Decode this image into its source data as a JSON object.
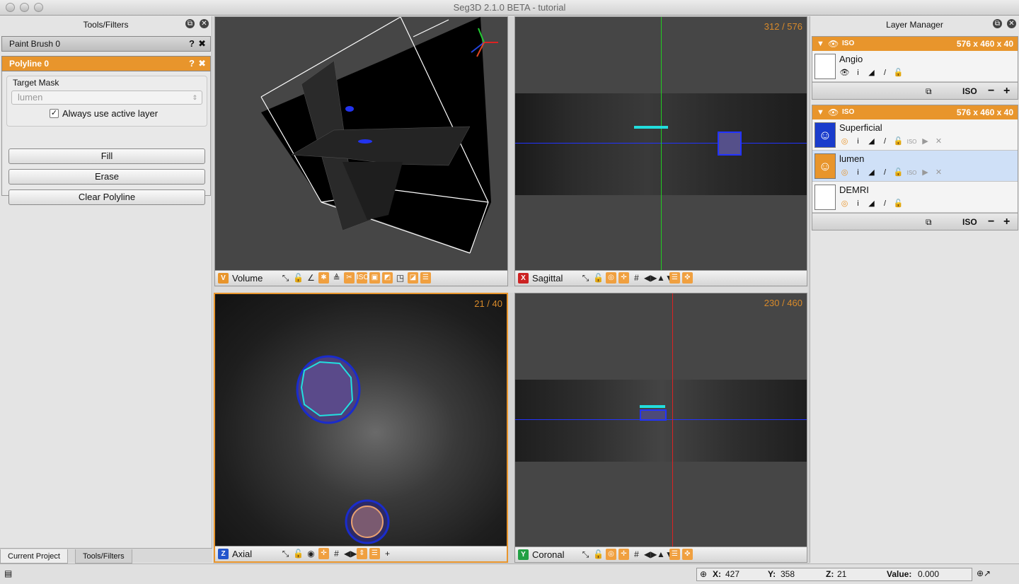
{
  "window": {
    "title": "Seg3D 2.1.0 BETA - tutorial"
  },
  "left_panel": {
    "title": "Tools/Filters",
    "tools": [
      {
        "name": "Paint Brush 0",
        "help": "?",
        "close": "✖"
      },
      {
        "name": "Polyline 0",
        "help": "?",
        "close": "✖"
      }
    ],
    "target_mask_label": "Target Mask",
    "target_mask_value": "lumen",
    "always_active_label": "Always use active layer",
    "always_active_checked": true,
    "buttons": {
      "fill": "Fill",
      "erase": "Erase",
      "clear": "Clear Polyline"
    },
    "bottom_tabs": [
      "Current Project",
      "Tools/Filters"
    ]
  },
  "viewers": {
    "volume": {
      "key": "V",
      "name": "Volume",
      "color": "#e8952c"
    },
    "sagittal": {
      "key": "X",
      "name": "Sagittal",
      "color": "#cc2222",
      "slice": "312 / 576"
    },
    "axial": {
      "key": "Z",
      "name": "Axial",
      "color": "#2255cc",
      "slice": "21 / 40"
    },
    "coronal": {
      "key": "Y",
      "name": "Coronal",
      "color": "#22a044",
      "slice": "230 / 460"
    }
  },
  "layer_manager": {
    "title": "Layer Manager",
    "groups": [
      {
        "iso": "ISO",
        "dims": "576 x 460 x 40",
        "layers": [
          {
            "name": "Angio",
            "type": "data"
          }
        ],
        "footer_iso": "ISO"
      },
      {
        "iso": "ISO",
        "dims": "576 x 460 x 40",
        "layers": [
          {
            "name": "Superficial",
            "type": "mask",
            "color": "#1a3ccc"
          },
          {
            "name": "lumen",
            "type": "mask",
            "color": "#e8952c",
            "active": true
          },
          {
            "name": "DEMRI",
            "type": "data"
          }
        ],
        "footer_iso": "ISO"
      }
    ]
  },
  "status": {
    "x_label": "X:",
    "x": "427",
    "y_label": "Y:",
    "y": "358",
    "z_label": "Z:",
    "z": "21",
    "value_label": "Value:",
    "value": "0.000"
  }
}
